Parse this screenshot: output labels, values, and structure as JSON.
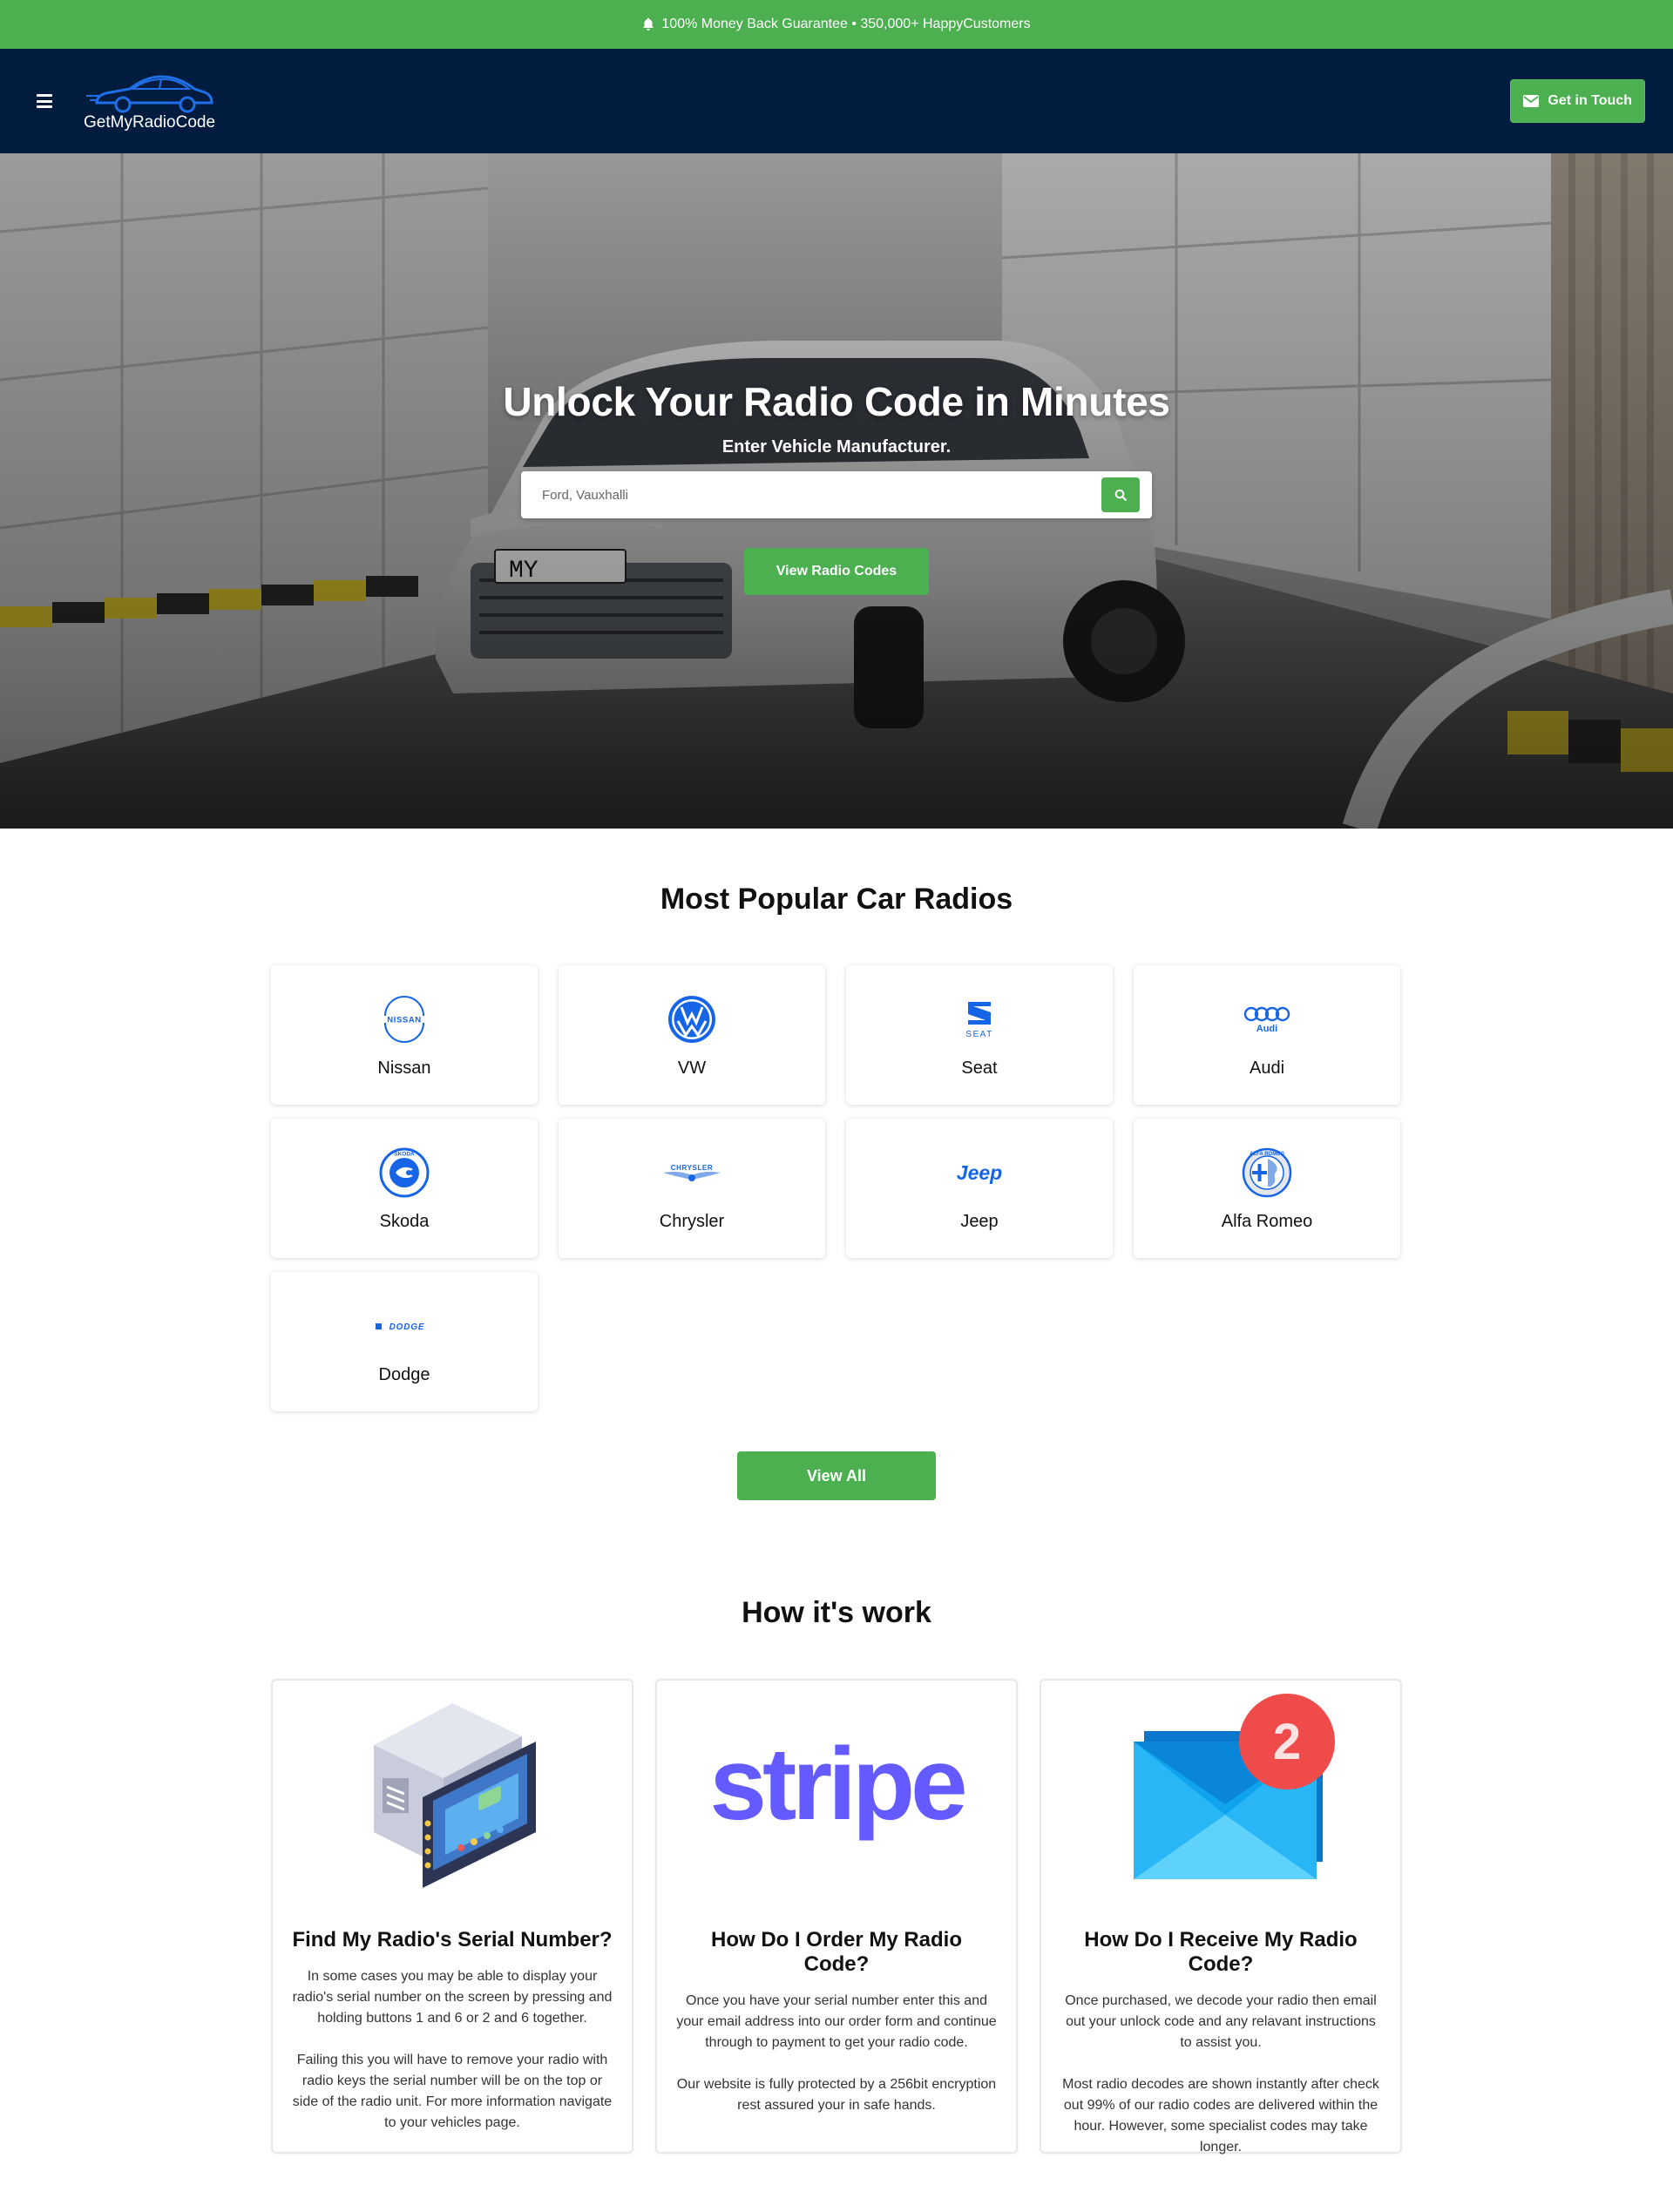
{
  "topbar": {
    "text": "100% Money Back Guarantee • 350,000+ HappyCustomers"
  },
  "header": {
    "logo_text": "GetMyRadioCode",
    "cta_label": "Get in Touch"
  },
  "hero": {
    "title": "Unlock Your Radio Code in Minutes",
    "subtitle": "Enter Vehicle Manufacturer.",
    "search_placeholder": "Ford, Vauxhalli",
    "button_label": "View Radio Codes",
    "plate_text": "MY"
  },
  "popular": {
    "title": "Most Popular Car Radios",
    "brands": [
      {
        "name": "Nissan",
        "logo_text": "NISSAN",
        "icon": "nissan-logo-icon"
      },
      {
        "name": "VW",
        "icon": "vw-logo-icon"
      },
      {
        "name": "Seat",
        "logo_text": "SEAT",
        "icon": "seat-logo-icon"
      },
      {
        "name": "Audi",
        "logo_text": "Audi",
        "icon": "audi-logo-icon"
      },
      {
        "name": "Skoda",
        "logo_text": "SKODA",
        "icon": "skoda-logo-icon"
      },
      {
        "name": "Chrysler",
        "logo_text": "CHRYSLER",
        "icon": "chrysler-logo-icon"
      },
      {
        "name": "Jeep",
        "logo_text": "Jeep",
        "icon": "jeep-logo-icon"
      },
      {
        "name": "Alfa Romeo",
        "logo_text": "ALFA ROMEO",
        "icon": "alfa-romeo-logo-icon"
      },
      {
        "name": "Dodge",
        "logo_text": "DODGE",
        "icon": "dodge-logo-icon"
      }
    ],
    "view_all_label": "View All"
  },
  "how": {
    "title": "How it's work",
    "cards": [
      {
        "title": "Find My Radio's Serial Number?",
        "p1": "In some cases you may be able to display your radio's serial number on the screen by pressing and holding buttons 1 and 6 or 2 and 6 together.",
        "p2": "Failing this you will have to remove your radio with radio keys the serial number will be on the top or side of the radio unit. For more information navigate to your vehicles page.",
        "icon": "car-radio-icon"
      },
      {
        "title": "How Do I Order My Radio Code?",
        "p1": "Once you have your serial number enter this and your email address into our order form and continue through to payment to get your radio code.",
        "p2": "Our website is fully protected by a 256bit encryption rest assured your in safe hands.",
        "icon": "stripe-logo-icon",
        "logo_text": "stripe"
      },
      {
        "title": "How Do I Receive My Radio Code?",
        "p1": "Once purchased, we decode your radio then email out your unlock code and any relavant instructions to assist you.",
        "p2": "Most radio decodes are shown instantly after check out 99% of our radio codes are delivered within the hour. However, some specialist codes may take longer.",
        "icon": "email-notification-icon",
        "badge": "2"
      }
    ]
  },
  "colors": {
    "green": "#4caf50",
    "navy": "#021c40",
    "brand_blue": "#1565e6",
    "stripe": "#635bff"
  }
}
